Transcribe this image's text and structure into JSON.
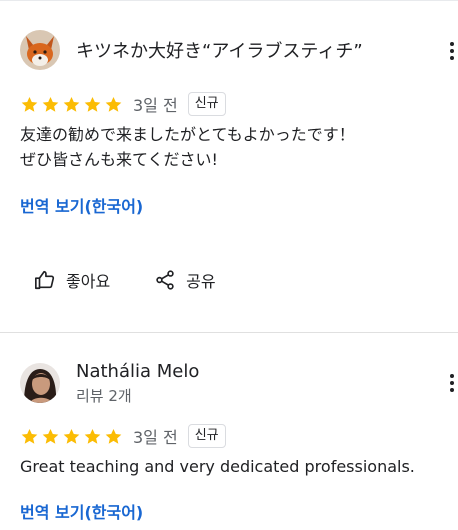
{
  "reviews": [
    {
      "author": "キツネか大好き“アイラブスティチ”",
      "author_sub": "",
      "stars": 5,
      "time_ago": "3일 전",
      "badge": "신규",
      "lines": [
        "友達の勧めで来ましたがとてもよかったです！",
        "ぜひ皆さんも来てください!"
      ],
      "translate_label": "번역 보기(한국어)",
      "like_label": "좋아요",
      "share_label": "공유"
    },
    {
      "author": "Nathália Melo",
      "author_sub": "리뷰 2개",
      "stars": 5,
      "time_ago": "3일 전",
      "badge": "신규",
      "lines": [
        "Great teaching and very dedicated professionals."
      ],
      "translate_label": "번역 보기(한국어)"
    }
  ],
  "icons": {
    "more": "more-vert-icon",
    "star": "star-icon",
    "like": "thumbs-up-icon",
    "share": "share-icon"
  },
  "colors": {
    "star": "#fbbc04",
    "link": "#1967d2",
    "text": "#202124",
    "muted": "#5f6368"
  }
}
